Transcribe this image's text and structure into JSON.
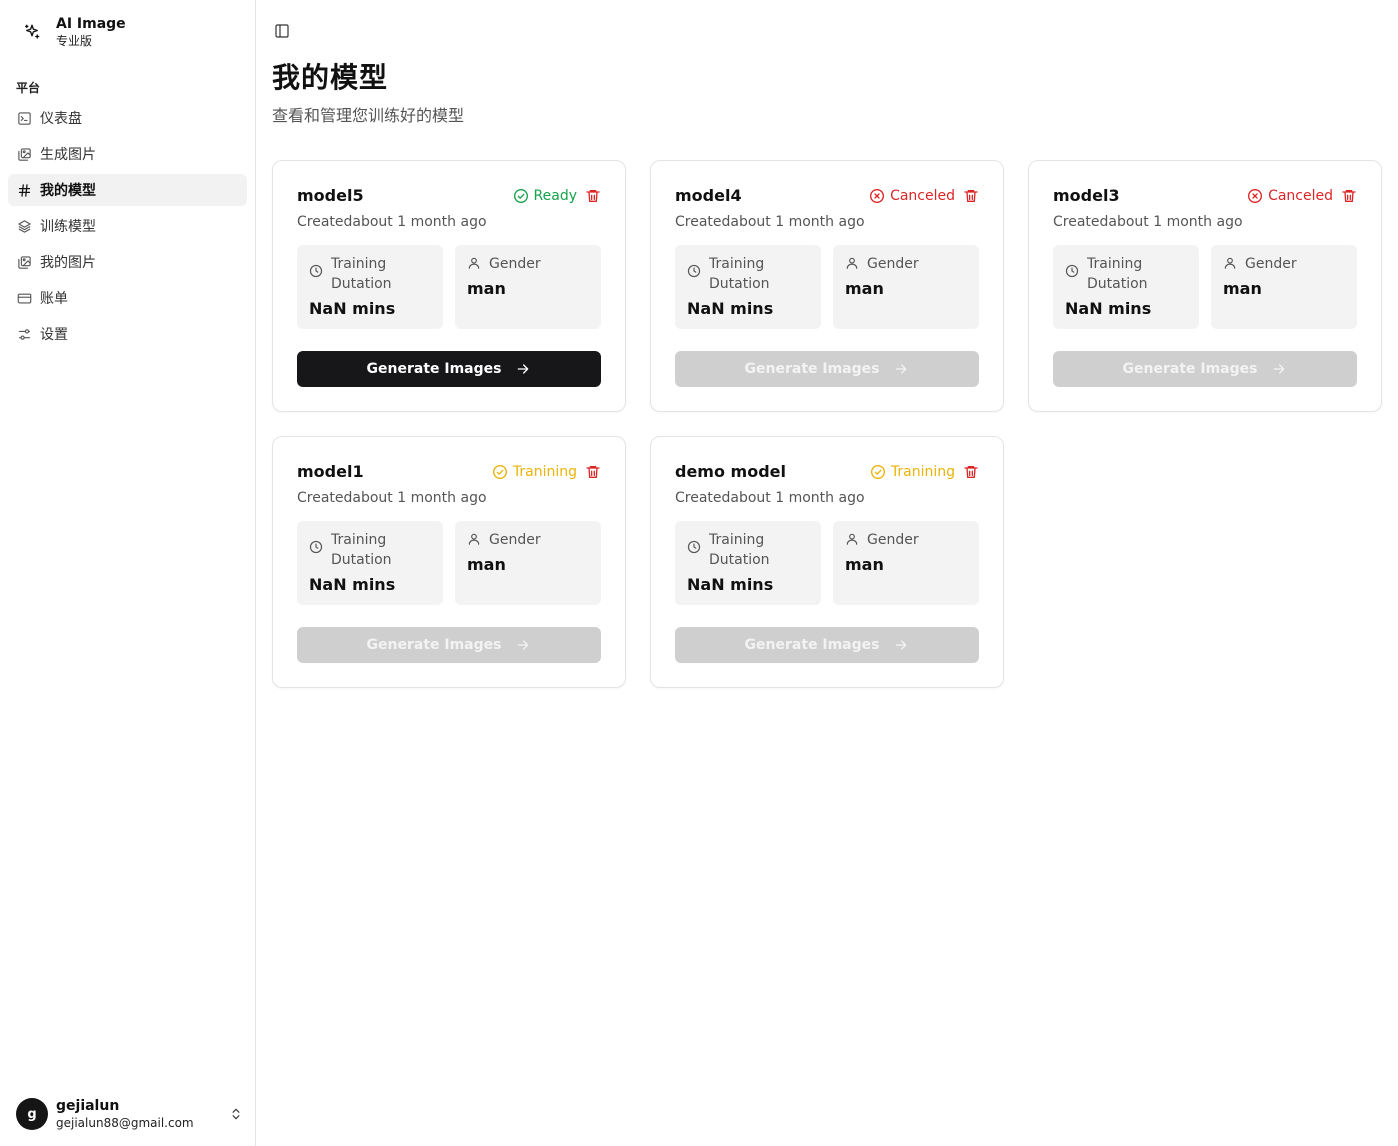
{
  "brand": {
    "title": "AI Image",
    "subtitle": "专业版"
  },
  "sidebar": {
    "group_label": "平台",
    "items": [
      {
        "label": "仪表盘",
        "icon": "terminal-icon",
        "active": false
      },
      {
        "label": "生成图片",
        "icon": "images-icon",
        "active": false
      },
      {
        "label": "我的模型",
        "icon": "hash-icon",
        "active": true
      },
      {
        "label": "训练模型",
        "icon": "layers-icon",
        "active": false
      },
      {
        "label": "我的图片",
        "icon": "images-icon",
        "active": false
      },
      {
        "label": "账单",
        "icon": "credit-card-icon",
        "active": false
      },
      {
        "label": "设置",
        "icon": "sliders-icon",
        "active": false
      }
    ]
  },
  "user": {
    "initial": "g",
    "name": "gejialun",
    "email": "gejialun88@gmail.com"
  },
  "header": {
    "title": "我的模型",
    "subtitle": "查看和管理您训练好的模型"
  },
  "colors": {
    "ready": "#16a34a",
    "canceled": "#dc2626",
    "training": "#eab308",
    "trash": "#dc2626"
  },
  "models": [
    {
      "name": "model5",
      "status": "Ready",
      "status_kind": "ready",
      "created": "Createdabout 1 month ago",
      "duration_label": "Training Dutation",
      "duration": "NaN mins",
      "gender_label": "Gender",
      "gender": "man",
      "button": "Generate Images",
      "enabled": true
    },
    {
      "name": "model4",
      "status": "Canceled",
      "status_kind": "canceled",
      "created": "Createdabout 1 month ago",
      "duration_label": "Training Dutation",
      "duration": "NaN mins",
      "gender_label": "Gender",
      "gender": "man",
      "button": "Generate Images",
      "enabled": false
    },
    {
      "name": "model3",
      "status": "Canceled",
      "status_kind": "canceled",
      "created": "Createdabout 1 month ago",
      "duration_label": "Training Dutation",
      "duration": "NaN mins",
      "gender_label": "Gender",
      "gender": "man",
      "button": "Generate Images",
      "enabled": false
    },
    {
      "name": "model1",
      "status": "Tranining",
      "status_kind": "training",
      "created": "Createdabout 1 month ago",
      "duration_label": "Training Dutation",
      "duration": "NaN mins",
      "gender_label": "Gender",
      "gender": "man",
      "button": "Generate Images",
      "enabled": false
    },
    {
      "name": "demo model",
      "status": "Tranining",
      "status_kind": "training",
      "created": "Createdabout 1 month ago",
      "duration_label": "Training Dutation",
      "duration": "NaN mins",
      "gender_label": "Gender",
      "gender": "man",
      "button": "Generate Images",
      "enabled": false
    }
  ]
}
